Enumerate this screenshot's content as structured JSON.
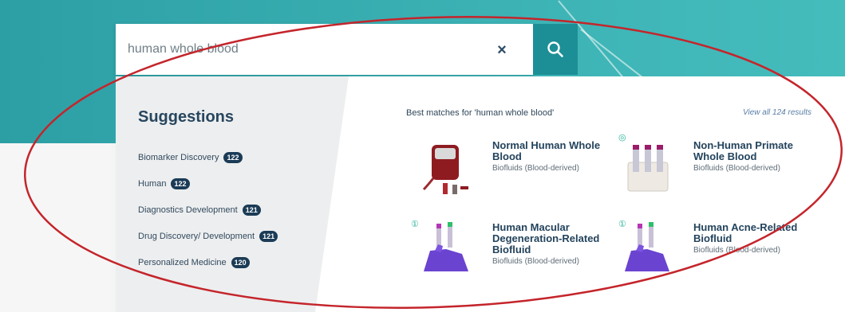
{
  "search": {
    "query": "human whole blood",
    "clear_label": "×"
  },
  "suggestions": {
    "title": "Suggestions",
    "items": [
      {
        "label": "Biomarker Discovery",
        "count": "122"
      },
      {
        "label": "Human",
        "count": "122"
      },
      {
        "label": "Diagnostics Development",
        "count": "121"
      },
      {
        "label": "Drug Discovery/ Development",
        "count": "121"
      },
      {
        "label": "Personalized Medicine",
        "count": "120"
      }
    ]
  },
  "results": {
    "heading": "Best matches for 'human whole blood'",
    "view_all": "View all 124 results",
    "cards": [
      {
        "title": "Normal Human Whole Blood",
        "subtitle": "Biofluids (Blood-derived)"
      },
      {
        "title": "Non-Human Primate Whole Blood",
        "subtitle": "Biofluids (Blood-derived)"
      },
      {
        "title": "Human Macular Degeneration-Related Biofluid",
        "subtitle": "Biofluids (Blood-derived)"
      },
      {
        "title": "Human Acne-Related Biofluid",
        "subtitle": "Biofluids (Blood-derived)"
      }
    ]
  },
  "colors": {
    "banner": "#3bb1b4",
    "search_button": "#1c8f96",
    "badge": "#1b3b56",
    "title_text": "#23435c",
    "annotation": "#c4252b"
  },
  "icons": {
    "search": "search-icon",
    "clear": "close-icon",
    "flag": "info-icon"
  }
}
